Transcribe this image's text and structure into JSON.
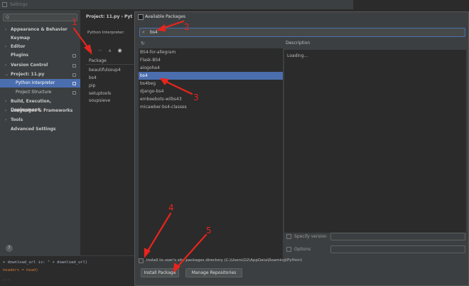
{
  "settings": {
    "window_title": "Settings",
    "search_placeholder": "Q",
    "nav": [
      {
        "label": "Appearance & Behavior",
        "expanded": false,
        "badge": false
      },
      {
        "label": "Keymap",
        "expanded": null,
        "badge": false
      },
      {
        "label": "Editor",
        "expanded": false,
        "badge": false
      },
      {
        "label": "Plugins",
        "expanded": null,
        "badge": true
      },
      {
        "label": "Version Control",
        "expanded": false,
        "badge": true
      },
      {
        "label": "Project: 11.py",
        "expanded": true,
        "badge": true
      },
      {
        "label": "Python Interpreter",
        "sub": true,
        "selected": true,
        "badge": true
      },
      {
        "label": "Project Structure",
        "sub": true,
        "badge": true
      },
      {
        "label": "Build, Execution, Deployment",
        "expanded": false,
        "badge": false
      },
      {
        "label": "Languages & Frameworks",
        "expanded": false,
        "badge": false
      },
      {
        "label": "Tools",
        "expanded": false,
        "badge": false
      },
      {
        "label": "Advanced Settings",
        "expanded": null,
        "badge": false
      }
    ],
    "help": "?"
  },
  "middle": {
    "breadcrumb": "Project: 11.py  ›  Pyt",
    "interpreter_label": "Python Interpreter:",
    "toolbar": {
      "add": "+",
      "remove": "−",
      "up": "▲",
      "eye": "◉"
    },
    "package_header": "Package",
    "packages": [
      "beautifulsoup4",
      "bs4",
      "pip",
      "setuptools",
      "soupsieve"
    ]
  },
  "terminal": {
    "lines": [
      {
        "text": "+ download_url is: \" + download_url)",
        "color": "#a9b7c6"
      },
      {
        "text": "headers = head)",
        "color": "#cc7832"
      },
      {
        "text": "...",
        "color": "#808080"
      }
    ]
  },
  "available_packages": {
    "title": "Available Packages",
    "search_value": "bs4",
    "results": [
      "BS4-for-allegram",
      "Flask-BS4",
      "aiogoha4",
      "bs4",
      "bs4beg",
      "django-bs4",
      "embeebots-wilbs43",
      "micawber-bs4-classes"
    ],
    "selected_index": 3,
    "description_label": "Description",
    "description_text": "Loading...",
    "specify_version_label": "Specify version",
    "options_label": "Options",
    "install_dir_label": "Install to user's site packages directory (C:\\Users\\O2\\AppData\\Roaming\\Python)",
    "install_button": "Install Package",
    "manage_button": "Manage Repositories"
  },
  "annotations": {
    "color": "#e8251c",
    "numbers": [
      "1",
      "2",
      "3",
      "4",
      "5"
    ]
  }
}
